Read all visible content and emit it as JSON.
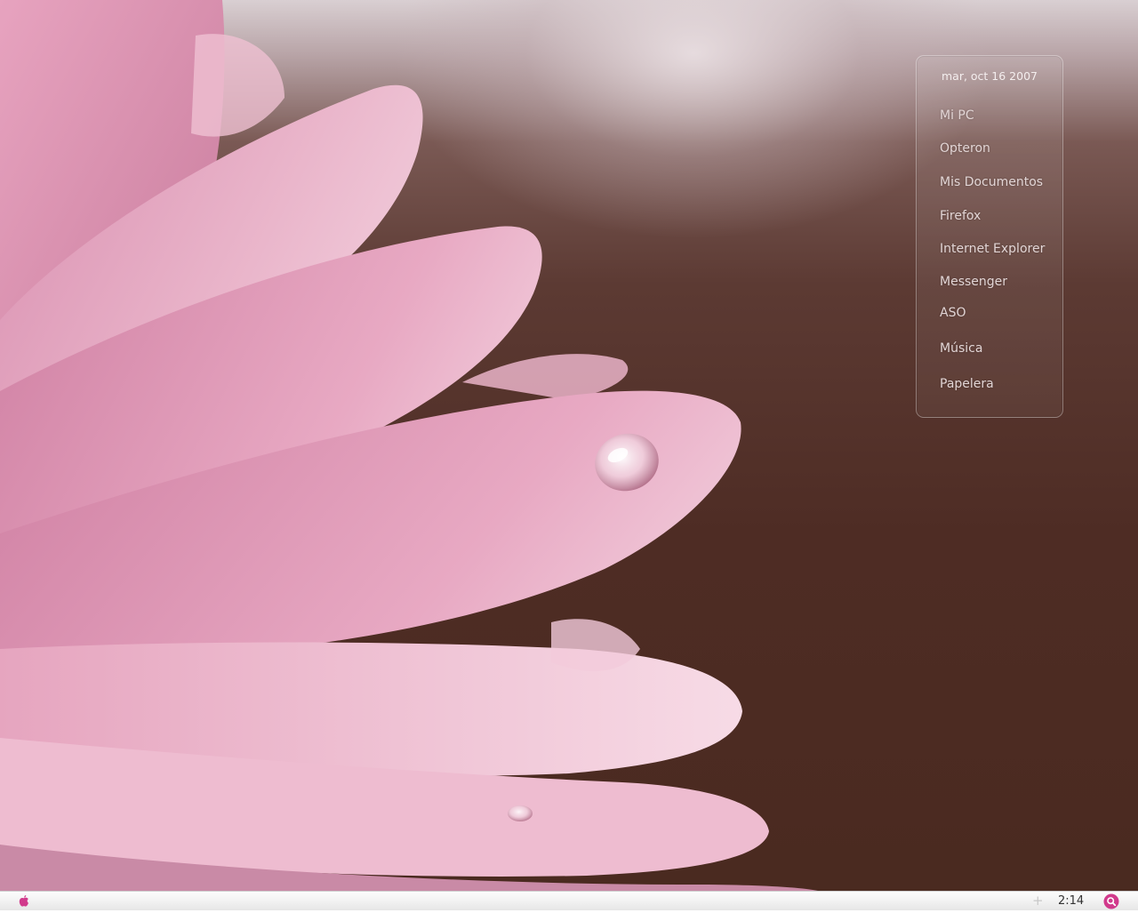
{
  "widget": {
    "date": "mar, oct 16 2007",
    "items": [
      {
        "label": "Mi PC"
      },
      {
        "label": "Opteron"
      },
      {
        "label": "Mis Documentos"
      },
      {
        "label": "Firefox"
      },
      {
        "label": "Internet Explorer"
      },
      {
        "label": "Messenger"
      },
      {
        "label": "ASO"
      },
      {
        "label": "Música"
      },
      {
        "label": "Papelera"
      }
    ]
  },
  "taskbar": {
    "start_icon": "apple-icon",
    "tray_icon": "plus-icon",
    "tray_symbol": "+",
    "clock": "2:14",
    "search_icon": "search-icon"
  },
  "colors": {
    "accent": "#d13a8c",
    "petal": "#e7a6c2"
  }
}
